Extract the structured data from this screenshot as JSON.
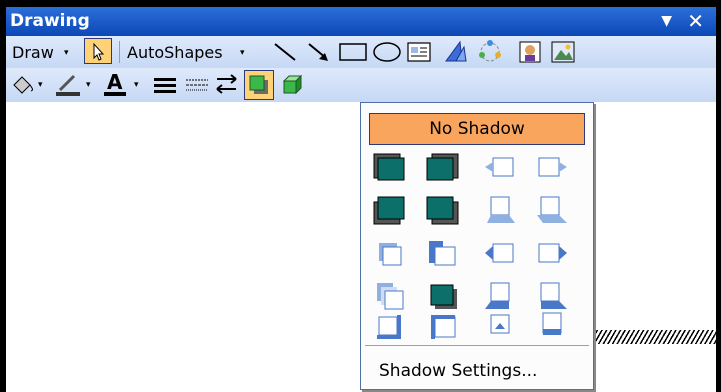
{
  "toolbar_title": "Drawing",
  "titlebar": {
    "dropdown_glyph": "▼",
    "close_glyph": "✕"
  },
  "row1": {
    "draw_label": "Draw",
    "autoshapes_label": "AutoShapes",
    "dropdown_glyph": "▾",
    "icons": [
      "select-objects-icon",
      "line-icon",
      "arrow-icon",
      "rectangle-icon",
      "oval-icon",
      "text-box-icon",
      "wordart-icon",
      "diagram-icon",
      "clip-art-icon",
      "picture-icon"
    ]
  },
  "row2": {
    "dropdown_glyph": "▾",
    "font_color_letter": "A",
    "icons": [
      "fill-color-icon",
      "line-color-icon",
      "font-color-icon",
      "line-style-icon",
      "dash-style-icon",
      "arrow-style-icon",
      "shadow-style-icon",
      "3d-style-icon"
    ]
  },
  "shadow_menu": {
    "no_shadow_label": "No Shadow",
    "shadow_settings_label": "Shadow Settings...",
    "accent": "#f9a55e",
    "shadow_fill": "#0d6f6a"
  }
}
